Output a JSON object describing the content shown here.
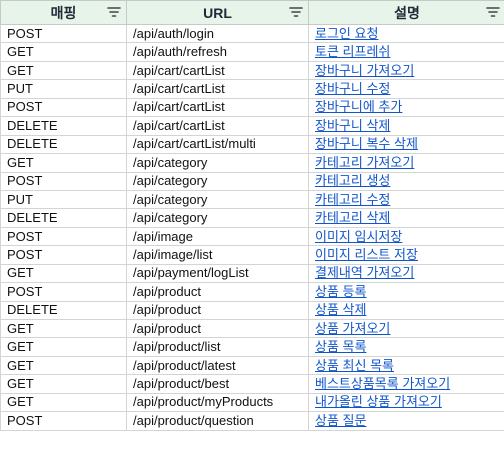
{
  "header": {
    "mapping": "매핑",
    "url": "URL",
    "description": "설명"
  },
  "rows": [
    {
      "method": "POST",
      "url": "/api/auth/login",
      "desc": "로그인 요청"
    },
    {
      "method": "GET",
      "url": "/api/auth/refresh",
      "desc": "토큰 리프레쉬"
    },
    {
      "method": "GET",
      "url": "/api/cart/cartList",
      "desc": "장바구니 가져오기"
    },
    {
      "method": "PUT",
      "url": "/api/cart/cartList",
      "desc": "장바구니 수정"
    },
    {
      "method": "POST",
      "url": "/api/cart/cartList",
      "desc": "장바구니에 추가"
    },
    {
      "method": "DELETE",
      "url": "/api/cart/cartList",
      "desc": "장바구니 삭제"
    },
    {
      "method": "DELETE",
      "url": "/api/cart/cartList/multi",
      "desc": "장바구니 복수 삭제"
    },
    {
      "method": "GET",
      "url": "/api/category",
      "desc": "카테고리 가져오기"
    },
    {
      "method": "POST",
      "url": "/api/category",
      "desc": "카테고리 생성"
    },
    {
      "method": "PUT",
      "url": "/api/category",
      "desc": "카테고리 수정"
    },
    {
      "method": "DELETE",
      "url": "/api/category",
      "desc": "카테고리 삭제"
    },
    {
      "method": "POST",
      "url": "/api/image",
      "desc": "이미지 임시저장"
    },
    {
      "method": "POST",
      "url": "/api/image/list",
      "desc": "이미지 리스트 저장"
    },
    {
      "method": "GET",
      "url": "/api/payment/logList",
      "desc": "결제내역 가져오기"
    },
    {
      "method": "POST",
      "url": "/api/product",
      "desc": "상품 등록"
    },
    {
      "method": "DELETE",
      "url": "/api/product",
      "desc": "상품 삭제"
    },
    {
      "method": "GET",
      "url": "/api/product",
      "desc": "상품 가져오기"
    },
    {
      "method": "GET",
      "url": "/api/product/list",
      "desc": "상품 목록"
    },
    {
      "method": "GET",
      "url": "/api/product/latest",
      "desc": "상품 최신 목록"
    },
    {
      "method": "GET",
      "url": "/api/product/best",
      "desc": "베스트상품목록 가져오기"
    },
    {
      "method": "GET",
      "url": "/api/product/myProducts",
      "desc": "내가올린 상품 가져오기"
    },
    {
      "method": "POST",
      "url": "/api/product/question",
      "desc": "상품 질문"
    }
  ],
  "icons": {
    "filter": "filter-icon"
  },
  "colors": {
    "header_bg": "#e6f4ea",
    "link": "#1155cc",
    "grid": "#d4d4d4"
  }
}
